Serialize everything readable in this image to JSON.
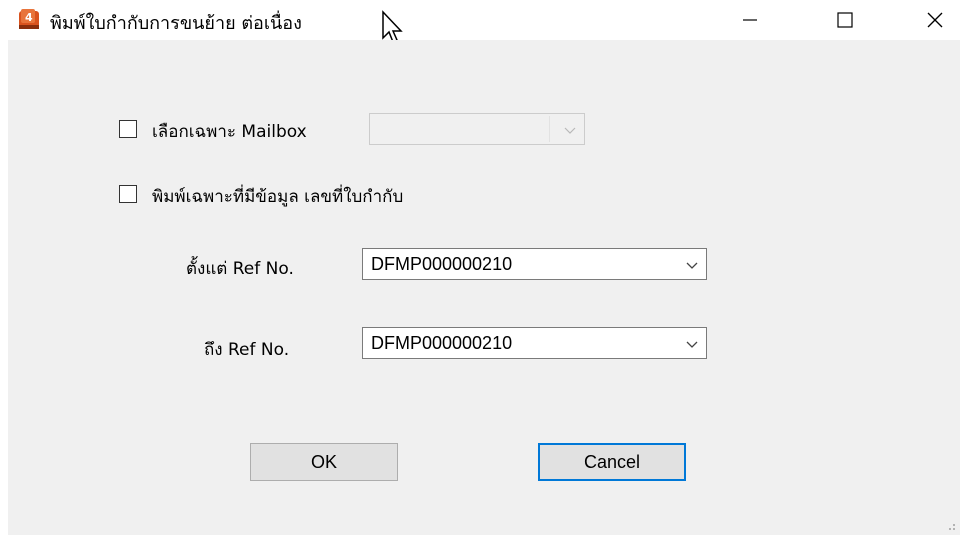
{
  "window": {
    "title": "พิมพ์ใบกำกับการขนย้าย ต่อเนื่อง",
    "icon": "app-logo-icon",
    "controls": [
      "minimize-icon",
      "maximize-icon",
      "close-icon"
    ]
  },
  "mailbox": {
    "checked": false,
    "label": "เลือกเฉพาะ Mailbox",
    "select_value": "",
    "enabled": false
  },
  "print_filter": {
    "checked": false,
    "label": "พิมพ์เฉพาะที่มีข้อมูล เลขที่ใบกำกับ"
  },
  "ref_from": {
    "label": "ตั้งแต่ Ref No.",
    "value": "DFMP000000210"
  },
  "ref_to": {
    "label": "ถึง Ref No.",
    "value": "DFMP000000210"
  },
  "buttons": {
    "ok": "OK",
    "cancel": "Cancel"
  },
  "colors": {
    "dialog_bg": "#f0f0f0",
    "accent": "#0078d7",
    "icon_orange": "#d9531e"
  }
}
